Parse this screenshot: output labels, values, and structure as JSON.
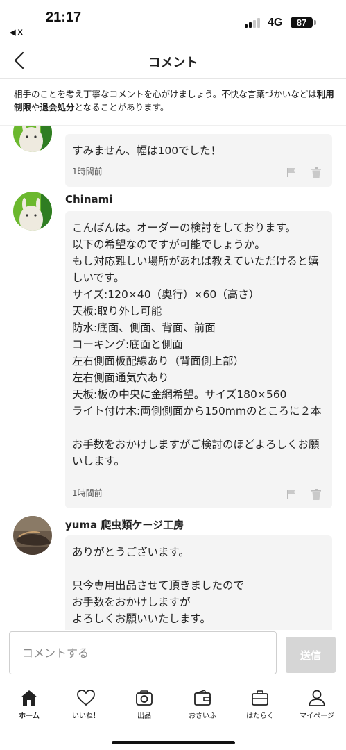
{
  "status_bar": {
    "time": "21:17",
    "back_app": "◀ X",
    "network": "4G",
    "battery": "87"
  },
  "header": {
    "title": "コメント"
  },
  "notice": {
    "part1": "相手のことを考え丁寧なコメントを心がけましょう。不快な言葉づかいなどは",
    "bold1": "利用制限",
    "part2": "や",
    "bold2": "退会処分",
    "part3": "となることがあります。"
  },
  "comments": [
    {
      "author": "",
      "text": "すみません、幅は100でした！",
      "time": "1時間前"
    },
    {
      "author": "Chinami",
      "text": "こんばんは。オーダーの検討をしております。\n以下の希望なのですが可能でしょうか。\nもし対応難しい場所があれば教えていただけると嬉しいです。\nサイズ:120×40（奥行）×60（高さ）\n天板:取り外し可能\n防水:底面、側面、背面、前面\nコーキング:底面と側面\n左右側面板配線あり（背面側上部）\n左右側面通気穴あり\n天板:板の中央に金網希望。サイズ180×560\nライト付け木:両側側面から150mmのところに２本\n\nお手数をおかけしますがご検討のほどよろしくお願いします。",
      "time": "1時間前"
    },
    {
      "author": "yuma 爬虫類ケージ工房",
      "text": "ありがとうございます。\n\n只今専用出品させて頂きましたので\nお手数をおかけしますが\nよろしくお願いいたします。",
      "time": ""
    }
  ],
  "input": {
    "placeholder": "コメントする",
    "send_label": "送信"
  },
  "tabs": [
    {
      "label": "ホーム",
      "icon": "home-icon",
      "active": true
    },
    {
      "label": "いいね！",
      "icon": "heart-icon",
      "active": false
    },
    {
      "label": "出品",
      "icon": "camera-icon",
      "active": false
    },
    {
      "label": "おさいふ",
      "icon": "wallet-icon",
      "active": false
    },
    {
      "label": "はたらく",
      "icon": "briefcase-icon",
      "active": false
    },
    {
      "label": "マイページ",
      "icon": "person-icon",
      "active": false
    }
  ]
}
